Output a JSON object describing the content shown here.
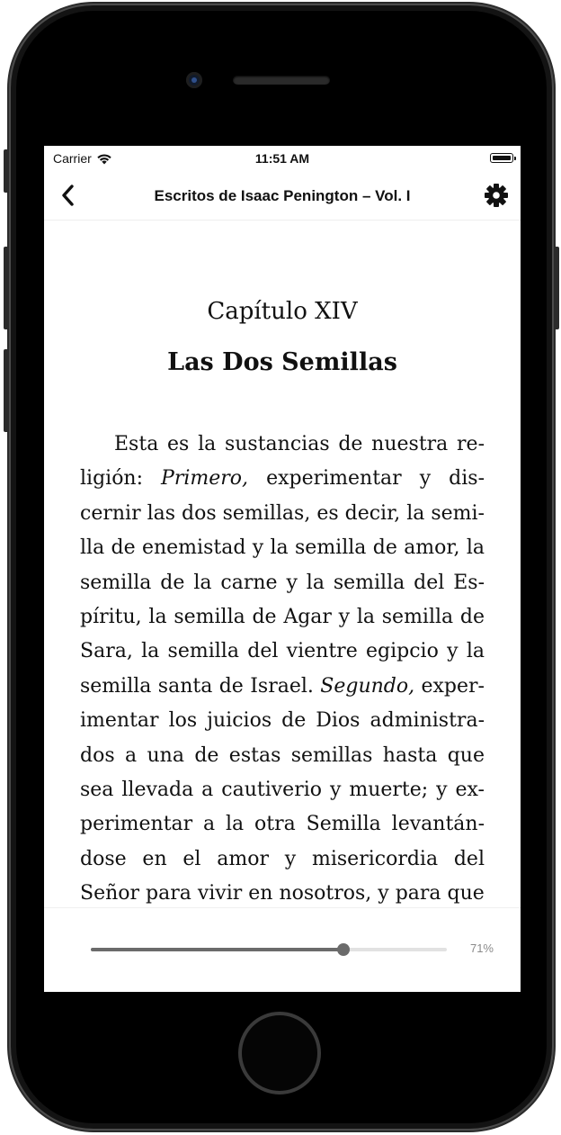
{
  "status_bar": {
    "carrier": "Carrier",
    "time": "11:51 AM"
  },
  "nav": {
    "title": "Escritos de Isaac Penington – Vol. I",
    "back_icon": "chevron-left-icon",
    "settings_icon": "gear-icon"
  },
  "chapter": {
    "label": "Capítulo XIV",
    "title": "Las Dos Semillas"
  },
  "body_lines": [
    {
      "parts": [
        {
          "text": "Esta es la sustancias de nuestra re-"
        }
      ]
    },
    {
      "parts": [
        {
          "text": "ligión: "
        },
        {
          "text": "Primero,",
          "italic": true
        },
        {
          "text": " experimentar y dis-"
        }
      ]
    },
    {
      "parts": [
        {
          "text": "cernir las dos semillas, es decir, la semi-"
        }
      ]
    },
    {
      "parts": [
        {
          "text": "lla de enemistad y la semilla de amor, la"
        }
      ]
    },
    {
      "parts": [
        {
          "text": "semilla de la carne y la semilla del Es-"
        }
      ]
    },
    {
      "parts": [
        {
          "text": "píritu, la semilla de Agar y la semilla de"
        }
      ]
    },
    {
      "parts": [
        {
          "text": "Sara, la semilla del vientre egipcio y la"
        }
      ]
    },
    {
      "parts": [
        {
          "text": "semilla santa de Israel. "
        },
        {
          "text": "Segundo,",
          "italic": true
        },
        {
          "text": " exper-"
        }
      ]
    },
    {
      "parts": [
        {
          "text": "imentar los juicios de Dios administra-"
        }
      ]
    },
    {
      "parts": [
        {
          "text": "dos a una de estas semillas hasta que"
        }
      ]
    },
    {
      "parts": [
        {
          "text": "sea llevada a cautiverio y muerte; y ex-"
        }
      ]
    },
    {
      "parts": [
        {
          "text": "perimentar a la otra Semilla levantán-"
        }
      ]
    },
    {
      "parts": [
        {
          "text": "dose en el amor y misericordia del"
        }
      ]
    },
    {
      "parts": [
        {
          "text": "Señor para vivir en nosotros, y para que"
        }
      ]
    }
  ],
  "progress": {
    "value": 0.71,
    "label": "71%"
  },
  "colors": {
    "slider_fill": "#6b6b6b",
    "slider_track": "#e2e2e2",
    "text": "#111111"
  }
}
